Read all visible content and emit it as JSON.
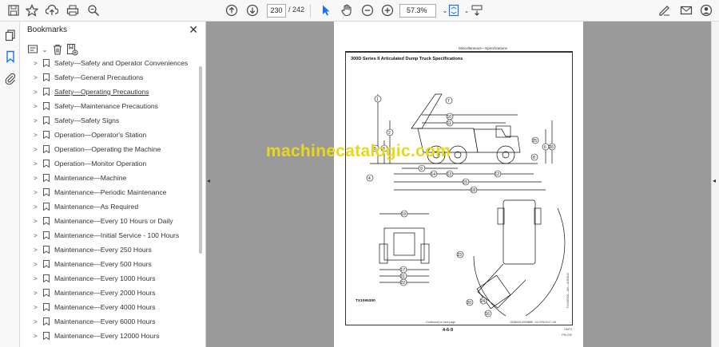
{
  "toolbar": {
    "page_current": "230",
    "page_total": "/ 242",
    "zoom": "57.3%"
  },
  "bookmarks": {
    "title": "Bookmarks",
    "items": [
      {
        "label": "Safety—Safety and Operator Conveniences"
      },
      {
        "label": "Safety—General Precautions"
      },
      {
        "label": "Safety—Operating Precautions",
        "active": true
      },
      {
        "label": "Safety—Maintenance Precautions"
      },
      {
        "label": "Safety—Safety Signs"
      },
      {
        "label": "Operation—Operator's Station"
      },
      {
        "label": "Operation—Operating the Machine"
      },
      {
        "label": "Operation—Monitor Operation"
      },
      {
        "label": "Maintenance—Machine"
      },
      {
        "label": "Maintenance—Periodic Maintenance"
      },
      {
        "label": "Maintenance—As Required"
      },
      {
        "label": "Maintenance—Every 10 Hours or Daily"
      },
      {
        "label": "Maintenance—Initial Service - 100 Hours"
      },
      {
        "label": "Maintenance—Every 250 Hours"
      },
      {
        "label": "Maintenance—Every 500 Hours"
      },
      {
        "label": "Maintenance—Every 1000 Hours"
      },
      {
        "label": "Maintenance—Every 2000 Hours"
      },
      {
        "label": "Maintenance—Every 4000 Hours"
      },
      {
        "label": "Maintenance—Every 6000 Hours"
      },
      {
        "label": "Maintenance—Every 12000 Hours"
      }
    ]
  },
  "document": {
    "header": "Miscellaneous—Specifications",
    "spec_title": "300D Series II Articulated Dump Truck Specifications",
    "figure_id": "TX1065300",
    "figure_id_side": "TX1065300—UN—16JUN12",
    "continued": "Continued on next page",
    "continued_code": "JD38640,0000B8E -19-07NOV17-1/8",
    "page_number": "4-6-9",
    "footer_code": "OMT3",
    "footer_date": "PN=230",
    "callouts": [
      "1",
      "2",
      "3",
      "4",
      "5",
      "6",
      "7",
      "8",
      "9",
      "10",
      "11",
      "12",
      "13",
      "14",
      "15",
      "16",
      "17",
      "18",
      "19",
      "20",
      "21",
      "22",
      "23",
      "24",
      "25",
      "26"
    ]
  },
  "watermark": "machinecatalogic.com",
  "colors": {
    "toolbar_bg": "#f8f8f8",
    "doc_bg": "#9a9a9a",
    "watermark": "#e8d81a",
    "active_blue": "#1a73e8"
  }
}
